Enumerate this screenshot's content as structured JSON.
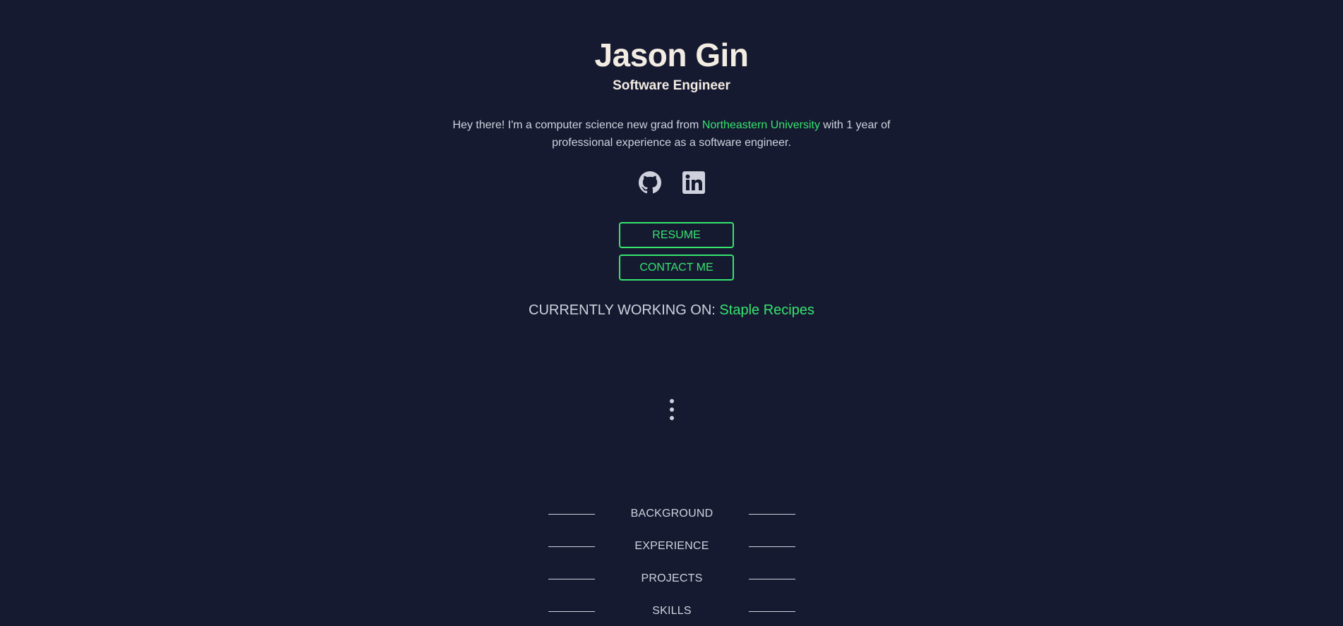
{
  "header": {
    "name": "Jason Gin",
    "role": "Software Engineer"
  },
  "intro": {
    "before": "Hey there! I'm a computer science new grad from ",
    "school": "Northeastern University",
    "after": " with 1 year of professional experience as a software engineer."
  },
  "socials": [
    {
      "icon": "github-icon"
    },
    {
      "icon": "linkedin-icon"
    }
  ],
  "buttons": {
    "resume": "RESUME",
    "contact": "CONTACT ME"
  },
  "working": {
    "label": "CURRENTLY WORKING ON: ",
    "project": "Staple Recipes"
  },
  "nav": {
    "items": [
      {
        "label": "BACKGROUND"
      },
      {
        "label": "EXPERIENCE"
      },
      {
        "label": "PROJECTS"
      },
      {
        "label": "SKILLS"
      }
    ]
  },
  "colors": {
    "background": "#161a31",
    "accent": "#35e46e",
    "heading": "#f3ece2",
    "text": "#cfd2dc"
  }
}
